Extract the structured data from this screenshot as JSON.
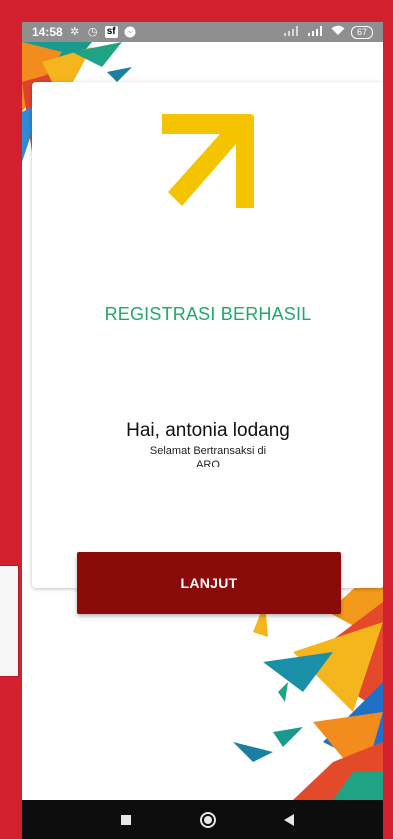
{
  "status_bar": {
    "time": "14:58",
    "sf_label": "sf",
    "battery_level": "67",
    "icons": [
      "sync-icon",
      "alarm-icon",
      "sf-icon",
      "messenger-icon",
      "signal-icon",
      "signal-icon",
      "wifi-icon",
      "battery-icon"
    ]
  },
  "registration": {
    "title": "REGISTRASI BERHASIL",
    "greeting": "Hai, antonia lodang",
    "subtitle_line1": "Selamat Bertransaksi di",
    "subtitle_line2": "ARO"
  },
  "actions": {
    "continue_label": "LANJUT"
  },
  "nav_bar": {
    "icons": [
      "recent-apps-icon",
      "home-icon",
      "back-icon"
    ]
  },
  "colors": {
    "frame_red": "#d3202e",
    "title_green": "#20a86b",
    "button_maroon": "#8b0a0a",
    "logo_yellow": "#f5c400",
    "status_bar": "#8f8f8f",
    "nav_bar": "#0d0d0d"
  }
}
